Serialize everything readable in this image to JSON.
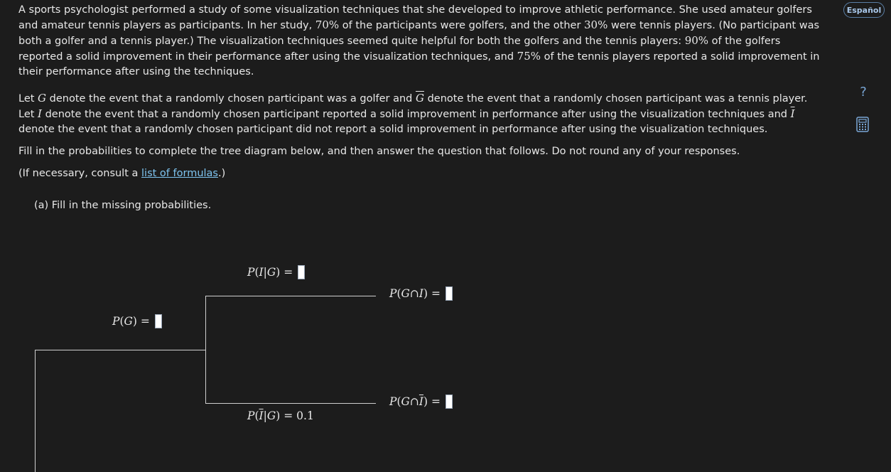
{
  "problem": {
    "para1": {
      "t1": "A sports psychologist performed a study of some visualization techniques that she developed to improve athletic performance. She used amateur golfers and amateur tennis players as participants. In her study, ",
      "pct_golfers": "70%",
      "t2": " of the participants were golfers, and the other ",
      "pct_tennis": "30%",
      "t3": " were tennis players. (No participant was both a golfer and a tennis player.) The visualization techniques seemed quite helpful for both the golfers and the tennis players: ",
      "pct_golf_improve": "90%",
      "t4": " of the golfers reported a solid improvement in their performance after using the visualization techniques, and ",
      "pct_tennis_improve": "75%",
      "t5": " of the tennis players reported a solid improvement in their performance after using the techniques."
    },
    "para2": {
      "t1": "Let ",
      "g": "G",
      "t2": " denote the event that a randomly chosen participant was a golfer and ",
      "gbar": "G",
      "t3": " denote the event that a randomly chosen participant was a tennis player. Let ",
      "i": "I",
      "t4": " denote the event that a randomly chosen participant reported a solid improvement in performance after using the visualization techniques and ",
      "ibar": "I",
      "t5": " denote the event that a randomly chosen participant did not report a solid improvement in performance after using the visualization techniques."
    },
    "para3": "Fill in the probabilities to complete the tree diagram below, and then answer the question that follows. Do not round any of your responses.",
    "para4": {
      "t1": "(If necessary, consult a ",
      "link": "list of formulas",
      "t2": ".)"
    },
    "part_a": "(a) Fill in the missing probabilities."
  },
  "toolbar": {
    "language_label": "Español",
    "help_label": "?"
  },
  "tree": {
    "p_g": {
      "label": "P",
      "open": "(",
      "event": "G",
      "close": ")",
      "eq": " = "
    },
    "p_i_given_g": {
      "label": "P",
      "open": "(",
      "event": "I",
      "bar": "|",
      "given": "G",
      "close": ")",
      "eq": " = "
    },
    "p_g_and_i": {
      "label": "P",
      "open": "(",
      "left": "G",
      "cap": "∩",
      "right": "I",
      "close": ")",
      "eq": " = "
    },
    "p_ibar_given_g": {
      "label": "P",
      "open": "(",
      "event": "I",
      "bar": "|",
      "given": "G",
      "close": ")",
      "eq": " = ",
      "value": "0.1"
    },
    "p_g_and_ibar": {
      "label": "P",
      "open": "(",
      "left": "G",
      "cap": "∩",
      "right": "I",
      "close": ")",
      "eq": " = "
    }
  }
}
